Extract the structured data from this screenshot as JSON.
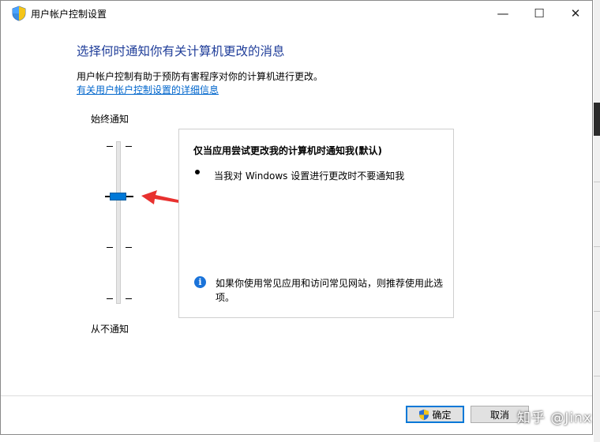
{
  "window": {
    "title": "用户帐户控制设置",
    "controls": {
      "minimize": "—",
      "maximize": "☐",
      "close": "✕"
    }
  },
  "main": {
    "heading": "选择何时通知你有关计算机更改的消息",
    "description": "用户帐户控制有助于预防有害程序对你的计算机进行更改。",
    "link": "有关用户帐户控制设置的详细信息"
  },
  "slider": {
    "top_label": "始终通知",
    "bottom_label": "从不通知",
    "levels": 4,
    "selected_level": 3
  },
  "info_box": {
    "title": "仅当应用尝试更改我的计算机时通知我(默认)",
    "bullets": [
      "当我对 Windows 设置进行更改时不要通知我"
    ],
    "note": "如果你使用常见应用和访问常见网站，则推荐使用此选项。",
    "note_icon": "i"
  },
  "buttons": {
    "ok": "确定",
    "cancel": "取消"
  },
  "watermark": "知乎 @Jinx",
  "colors": {
    "heading": "#1f3d99",
    "link": "#0066cc",
    "thumb": "#0078d7",
    "arrow": "#e8312f"
  }
}
